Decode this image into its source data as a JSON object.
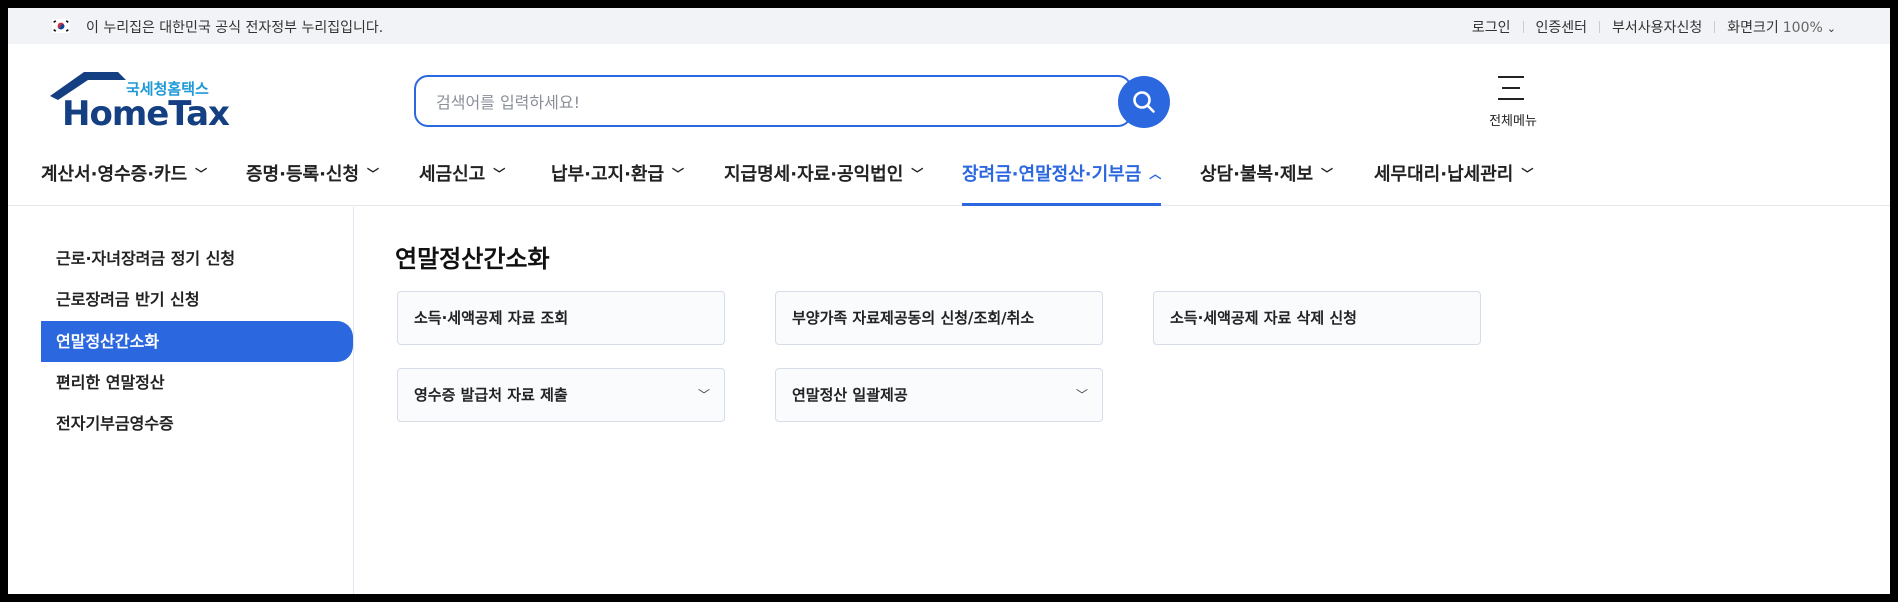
{
  "govbar": {
    "notice": "이 누리집은 대한민국 공식 전자정부 누리집입니다.",
    "login": "로그인",
    "cert_center": "인증센터",
    "dept_user": "부서사용자신청",
    "zoom_label": "화면크기",
    "zoom_value": "100%"
  },
  "logo": {
    "sub": "국세청홈택스",
    "main": "HomeTax"
  },
  "search": {
    "placeholder": "검색어를 입력하세요!"
  },
  "allmenu": {
    "label": "전체메뉴"
  },
  "gnb": [
    {
      "label": "계산서·영수증·카드"
    },
    {
      "label": "증명·등록·신청"
    },
    {
      "label": "세금신고"
    },
    {
      "label": "납부·고지·환급"
    },
    {
      "label": "지급명세·자료·공익법인"
    },
    {
      "label": "장려금·연말정산·기부금"
    },
    {
      "label": "상담·불복·제보"
    },
    {
      "label": "세무대리·납세관리"
    }
  ],
  "side": [
    {
      "label": "근로·자녀장려금 정기 신청"
    },
    {
      "label": "근로장려금 반기 신청"
    },
    {
      "label": "연말정산간소화"
    },
    {
      "label": "편리한 연말정산"
    },
    {
      "label": "전자기부금영수증"
    }
  ],
  "content": {
    "title": "연말정산간소화",
    "cards": [
      {
        "label": "소득·세액공제 자료 조회"
      },
      {
        "label": "부양가족 자료제공동의 신청/조회/취소"
      },
      {
        "label": "소득·세액공제 자료 삭제 신청"
      },
      {
        "label": "영수증 발급처 자료 제출"
      },
      {
        "label": "연말정산 일괄제공"
      }
    ]
  },
  "colors": {
    "accent": "#2b67de",
    "logo_navy": "#143f82",
    "logo_cyan": "#1d9ad6"
  }
}
